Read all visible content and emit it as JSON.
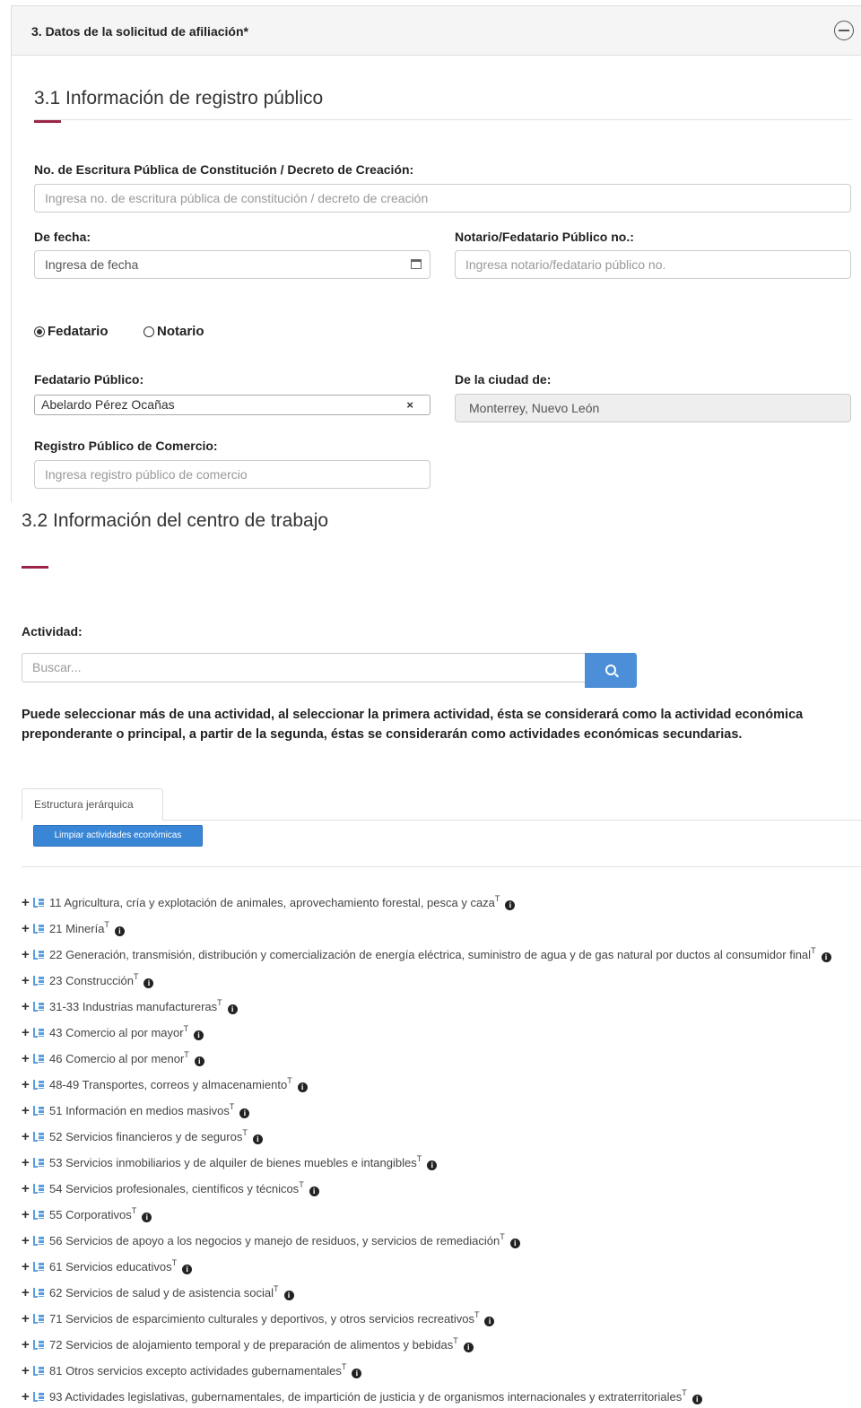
{
  "panel": {
    "title": "3. Datos de la solicitud de afiliación*"
  },
  "section31": {
    "title": "3.1 Información de registro público",
    "escritura_label": "No. de Escritura Pública de Constitución / Decreto de Creación:",
    "escritura_placeholder": "Ingresa no. de escritura pública de constitución / decreto de creación",
    "fecha_label": "De fecha:",
    "fecha_placeholder": "Ingresa de fecha",
    "notario_label": "Notario/Fedatario Público no.:",
    "notario_placeholder": "Ingresa notario/fedatario público no.",
    "radio_fedatario": "Fedatario",
    "radio_notario": "Notario",
    "fedatario_label": "Fedatario Público:",
    "fedatario_value": "Abelardo Pérez Ocañas",
    "fedatario_clear": "×",
    "ciudad_label": "De la ciudad de:",
    "ciudad_value": "Monterrey, Nuevo León",
    "registro_label": "Registro Público de Comercio:",
    "registro_placeholder": "Ingresa registro público de comercio"
  },
  "section32": {
    "title": "3.2 Información del centro de trabajo",
    "actividad_label": "Actividad:",
    "search_placeholder": "Buscar...",
    "note": "Puede seleccionar más de una actividad, al seleccionar la primera actividad, ésta se considerará como la actividad económica preponderante o principal, a partir de la segunda, éstas se considerarán como actividades económicas secundarias.",
    "tab_label": "Estructura jerárquica",
    "clear_button": "Limpiar actividades económicas"
  },
  "tree": [
    "11 Agricultura, cría y explotación de animales, aprovechamiento forestal, pesca y caza",
    "21 Minería",
    "22 Generación, transmisión, distribución y comercialización de energía eléctrica, suministro de agua y de gas natural por ductos al consumidor final",
    "23 Construcción",
    "31-33 Industrias manufactureras",
    "43 Comercio al por mayor",
    "46 Comercio al por menor",
    "48-49 Transportes, correos y almacenamiento",
    "51 Información en medios masivos",
    "52 Servicios financieros y de seguros",
    "53 Servicios inmobiliarios y de alquiler de bienes muebles e intangibles",
    "54 Servicios profesionales, científicos y técnicos",
    "55 Corporativos",
    "56 Servicios de apoyo a los negocios y manejo de residuos, y servicios de remediación",
    "61 Servicios educativos",
    "62 Servicios de salud y de asistencia social",
    "71 Servicios de esparcimiento culturales y deportivos, y otros servicios recreativos",
    "72 Servicios de alojamiento temporal y de preparación de alimentos y bebidas",
    "81 Otros servicios excepto actividades gubernamentales",
    "93 Actividades legislativas, gubernamentales, de impartición de justicia y de organismos internacionales y extraterritoriales"
  ],
  "tree_marker": "T",
  "colors": {
    "accent": "#9d2449",
    "primary_button": "#4c8fd8"
  }
}
